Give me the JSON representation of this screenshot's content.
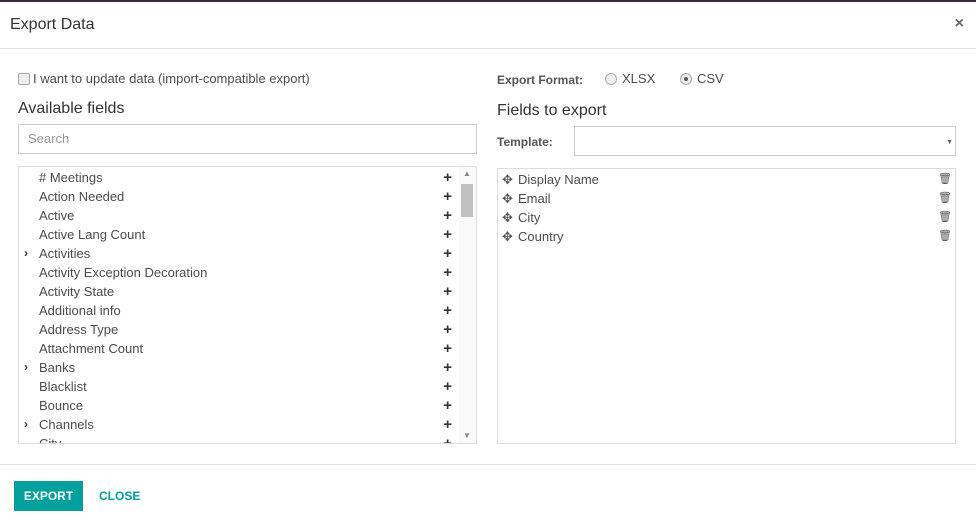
{
  "dialog": {
    "title": "Export Data",
    "close_icon": "×"
  },
  "left": {
    "import_compat_label": "I want to update data (import-compatible export)",
    "import_compat_checked": false,
    "heading": "Available fields",
    "search_placeholder": "Search",
    "fields": [
      {
        "label": "# Meetings",
        "expandable": false
      },
      {
        "label": "Action Needed",
        "expandable": false
      },
      {
        "label": "Active",
        "expandable": false
      },
      {
        "label": "Active Lang Count",
        "expandable": false
      },
      {
        "label": "Activities",
        "expandable": true
      },
      {
        "label": "Activity Exception Decoration",
        "expandable": false
      },
      {
        "label": "Activity State",
        "expandable": false
      },
      {
        "label": "Additional info",
        "expandable": false
      },
      {
        "label": "Address Type",
        "expandable": false
      },
      {
        "label": "Attachment Count",
        "expandable": false
      },
      {
        "label": "Banks",
        "expandable": true
      },
      {
        "label": "Blacklist",
        "expandable": false
      },
      {
        "label": "Bounce",
        "expandable": false
      },
      {
        "label": "Channels",
        "expandable": true
      },
      {
        "label": "City",
        "expandable": false
      }
    ]
  },
  "right": {
    "format_label": "Export Format:",
    "formats": [
      {
        "label": "XLSX",
        "selected": false
      },
      {
        "label": "CSV",
        "selected": true
      }
    ],
    "heading": "Fields to export",
    "template_label": "Template:",
    "template_value": "",
    "export_fields": [
      "Display Name",
      "Email",
      "City",
      "Country"
    ]
  },
  "footer": {
    "export_label": "EXPORT",
    "close_label": "CLOSE"
  },
  "colors": {
    "accent": "#00a09d"
  }
}
